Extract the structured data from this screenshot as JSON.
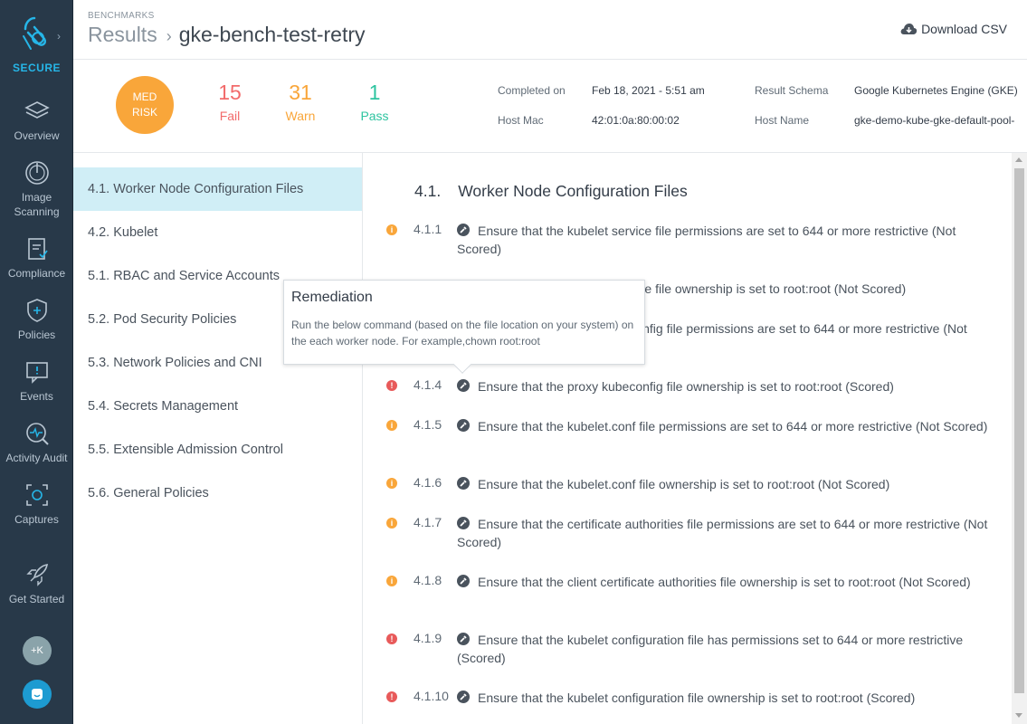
{
  "sidebar": {
    "brand_label": "SECURE",
    "items": [
      {
        "label": "Overview",
        "icon": "layers-icon"
      },
      {
        "label": "Image Scanning",
        "icon": "scan-icon"
      },
      {
        "label": "Compliance",
        "icon": "clipboard-icon"
      },
      {
        "label": "Policies",
        "icon": "shield-icon"
      },
      {
        "label": "Events",
        "icon": "events-icon"
      },
      {
        "label": "Activity Audit",
        "icon": "activity-icon"
      },
      {
        "label": "Captures",
        "icon": "capture-icon"
      }
    ],
    "get_started_label": "Get Started",
    "avatar_label": "+K"
  },
  "header": {
    "section": "BENCHMARKS",
    "parent": "Results",
    "separator": "›",
    "current": "gke-bench-test-retry",
    "download_label": "Download CSV"
  },
  "summary": {
    "risk_line1": "MED",
    "risk_line2": "RISK",
    "fail_count": "15",
    "fail_label": "Fail",
    "warn_count": "31",
    "warn_label": "Warn",
    "pass_count": "1",
    "pass_label": "Pass",
    "completed_label": "Completed on",
    "completed_value": "Feb 18, 2021 - 5:51 am",
    "hostmac_label": "Host Mac",
    "hostmac_value": "42:01:0a:80:00:02",
    "schema_label": "Result Schema",
    "schema_value": "Google Kubernetes Engine (GKE)",
    "hostname_label": "Host Name",
    "hostname_value": "gke-demo-kube-gke-default-pool-"
  },
  "sections": [
    "4.1. Worker Node Configuration Files",
    "4.2. Kubelet",
    "5.1. RBAC and Service Accounts",
    "5.2. Pod Security Policies",
    "5.3. Network Policies and CNI",
    "5.4. Secrets Management",
    "5.5. Extensible Admission Control",
    "5.6. General Policies"
  ],
  "detail": {
    "title_num": "4.1.",
    "title_text": "Worker Node Configuration Files",
    "checks": [
      {
        "id": "4.1.1",
        "status": "warn",
        "text": "Ensure that the kubelet service file permissions are set to 644 or more restrictive (Not Scored)"
      },
      {
        "id": "4.1.2",
        "status": "warn",
        "text": "Ensure that the kubelet service file ownership is set to root:root (Not Scored)"
      },
      {
        "id": "4.1.3",
        "status": "warn",
        "text": "Ensure that the proxy kubeconfig file permissions are set to 644 or more restrictive (Not Scored)"
      },
      {
        "id": "4.1.4",
        "status": "fail",
        "text": "Ensure that the proxy kubeconfig file ownership is set to root:root (Scored)"
      },
      {
        "id": "4.1.5",
        "status": "warn",
        "text": "Ensure that the kubelet.conf file permissions are set to 644 or more restrictive (Not Scored)"
      },
      {
        "id": "4.1.6",
        "status": "warn",
        "text": "Ensure that the kubelet.conf file ownership is set to root:root (Not Scored)"
      },
      {
        "id": "4.1.7",
        "status": "warn",
        "text": "Ensure that the certificate authorities file permissions are set to 644 or more restrictive (Not Scored)"
      },
      {
        "id": "4.1.8",
        "status": "warn",
        "text": "Ensure that the client certificate authorities file ownership is set to root:root (Not Scored)"
      },
      {
        "id": "4.1.9",
        "status": "fail",
        "text": "Ensure that the kubelet configuration file has permissions set to 644 or more restrictive (Scored)"
      },
      {
        "id": "4.1.10",
        "status": "fail",
        "text": "Ensure that the kubelet configuration file ownership is set to root:root (Scored)"
      }
    ]
  },
  "tooltip": {
    "title": "Remediation",
    "body": "Run the below command (based on the file location on your system) on the each worker node. For example,chown root:root"
  },
  "colors": {
    "sidebar_bg": "#283949",
    "brand": "#26b6e8",
    "fail": "#f26b6b",
    "warn": "#f9a63a",
    "pass": "#2ec4a0",
    "active_section_bg": "#d0eef6"
  }
}
